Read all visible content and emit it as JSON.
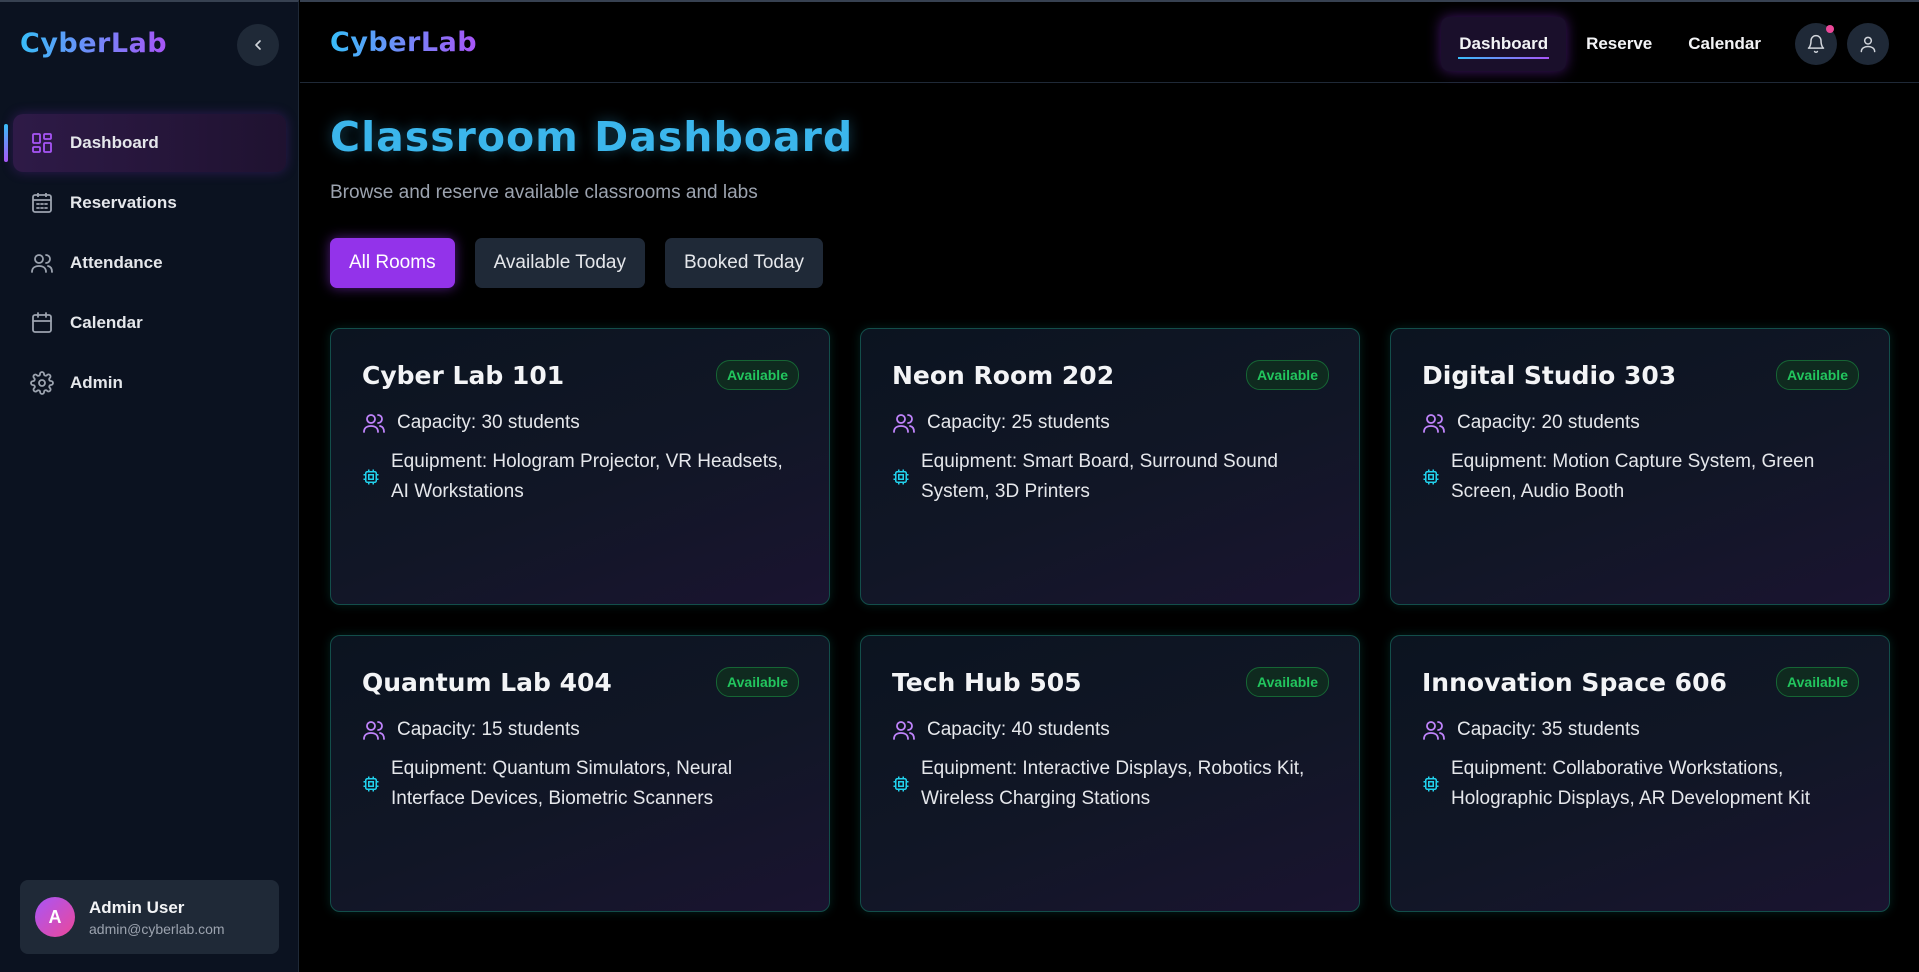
{
  "app": {
    "logo": "CyberLab"
  },
  "sidebar": {
    "items": [
      {
        "label": "Dashboard",
        "icon": "dashboard-icon",
        "active": true
      },
      {
        "label": "Reservations",
        "icon": "calendar-grid-icon"
      },
      {
        "label": "Attendance",
        "icon": "users-icon"
      },
      {
        "label": "Calendar",
        "icon": "calendar-icon"
      },
      {
        "label": "Admin",
        "icon": "gear-icon"
      }
    ],
    "user": {
      "initial": "A",
      "name": "Admin User",
      "email": "admin@cyberlab.com"
    }
  },
  "topbar": {
    "logo": "CyberLab",
    "links": [
      {
        "label": "Dashboard",
        "active": true
      },
      {
        "label": "Reserve"
      },
      {
        "label": "Calendar"
      }
    ]
  },
  "main": {
    "title": "Classroom Dashboard",
    "subtitle": "Browse and reserve available classrooms and labs",
    "filters": [
      {
        "label": "All Rooms",
        "active": true
      },
      {
        "label": "Available Today"
      },
      {
        "label": "Booked Today"
      }
    ],
    "rooms": [
      {
        "name": "Cyber Lab 101",
        "status": "Available",
        "capacity": "Capacity: 30 students",
        "equipment": "Equipment: Hologram Projector, VR Headsets, AI Workstations"
      },
      {
        "name": "Neon Room 202",
        "status": "Available",
        "capacity": "Capacity: 25 students",
        "equipment": "Equipment: Smart Board, Surround Sound System, 3D Printers"
      },
      {
        "name": "Digital Studio 303",
        "status": "Available",
        "capacity": "Capacity: 20 students",
        "equipment": "Equipment: Motion Capture System, Green Screen, Audio Booth"
      },
      {
        "name": "Quantum Lab 404",
        "status": "Available",
        "capacity": "Capacity: 15 students",
        "equipment": "Equipment: Quantum Simulators, Neural Interface Devices, Biometric Scanners"
      },
      {
        "name": "Tech Hub 505",
        "status": "Available",
        "capacity": "Capacity: 40 students",
        "equipment": "Equipment: Interactive Displays, Robotics Kit, Wireless Charging Stations"
      },
      {
        "name": "Innovation Space 606",
        "status": "Available",
        "capacity": "Capacity: 35 students",
        "equipment": "Equipment: Collaborative Workstations, Holographic Displays, AR Development Kit"
      }
    ]
  },
  "colors": {
    "accent": "#9333ea",
    "cyan": "#38bdf8",
    "available": "#22c55e",
    "notification": "#ec4899"
  }
}
